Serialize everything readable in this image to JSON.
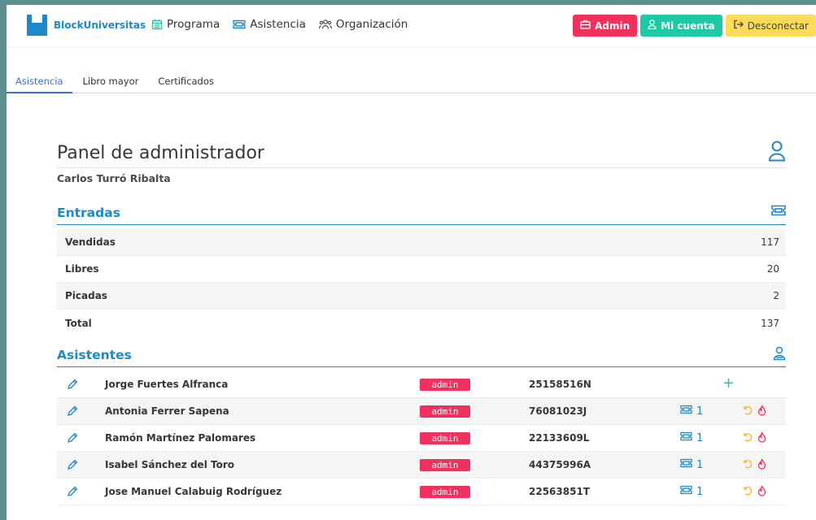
{
  "brand": {
    "name": "BlockUniversitas",
    "color": "#1e88c8"
  },
  "nav": {
    "links": [
      {
        "label": "Programa",
        "icon": "calendar-icon"
      },
      {
        "label": "Asistencia",
        "icon": "ticket-icon"
      },
      {
        "label": "Organización",
        "icon": "users-icon"
      }
    ],
    "buttons": {
      "admin": "Admin",
      "cuenta": "Mi cuenta",
      "desconectar": "Desconectar"
    }
  },
  "tabs": [
    "Asistencia",
    "Libro mayor",
    "Certificados"
  ],
  "active_tab": "Asistencia",
  "page": {
    "title": "Panel de administrador",
    "subtitle": "Carlos Turró Ribalta"
  },
  "entradas": {
    "title": "Entradas",
    "rows": [
      {
        "label": "Vendidas",
        "value": "117"
      },
      {
        "label": "Libres",
        "value": "20"
      },
      {
        "label": "Picadas",
        "value": "2"
      },
      {
        "label": "Total",
        "value": "137"
      }
    ]
  },
  "asistentes": {
    "title": "Asistentes",
    "rows": [
      {
        "name": "Jorge Fuertes Alfranca",
        "role": "admin",
        "dni": "25158516N",
        "tickets": "",
        "add": "+"
      },
      {
        "name": "Antonia Ferrer Sapena",
        "role": "admin",
        "dni": "76081023J",
        "tickets": "1",
        "add": ""
      },
      {
        "name": "Ramón Martínez Palomares",
        "role": "admin",
        "dni": "22133609L",
        "tickets": "1",
        "add": ""
      },
      {
        "name": "Isabel Sánchez del Toro",
        "role": "admin",
        "dni": "44375996A",
        "tickets": "1",
        "add": ""
      },
      {
        "name": "Jose Manuel Calabuig Rodríguez",
        "role": "admin",
        "dni": "22563851T",
        "tickets": "1",
        "add": ""
      }
    ]
  },
  "colors": {
    "accent": "#1e88c8",
    "danger": "#f0315e",
    "success": "#1fc9a5",
    "warning": "#fedb58",
    "active_tab": "#3273dc"
  }
}
